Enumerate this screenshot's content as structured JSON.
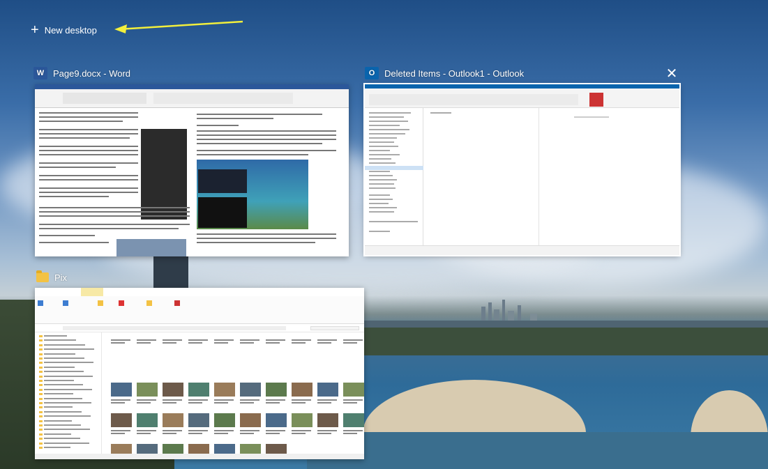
{
  "task_view": {
    "new_desktop_label": "New desktop"
  },
  "windows": [
    {
      "title": "Page9.docx - Word",
      "app": "Word",
      "icon": "word-icon",
      "icon_letter": "W"
    },
    {
      "title": "Deleted Items - Outlook1 - Outlook",
      "app": "Outlook",
      "icon": "outlook-icon",
      "icon_letter": "O",
      "selected": true,
      "close_glyph": "✕"
    },
    {
      "title": "Pix",
      "app": "File Explorer",
      "icon": "folder-icon"
    }
  ],
  "colors": {
    "word_brand": "#2b579a",
    "outlook_brand": "#0a64ad",
    "folder_yellow": "#f3c244",
    "annotation_arrow": "#f2ef3c"
  }
}
